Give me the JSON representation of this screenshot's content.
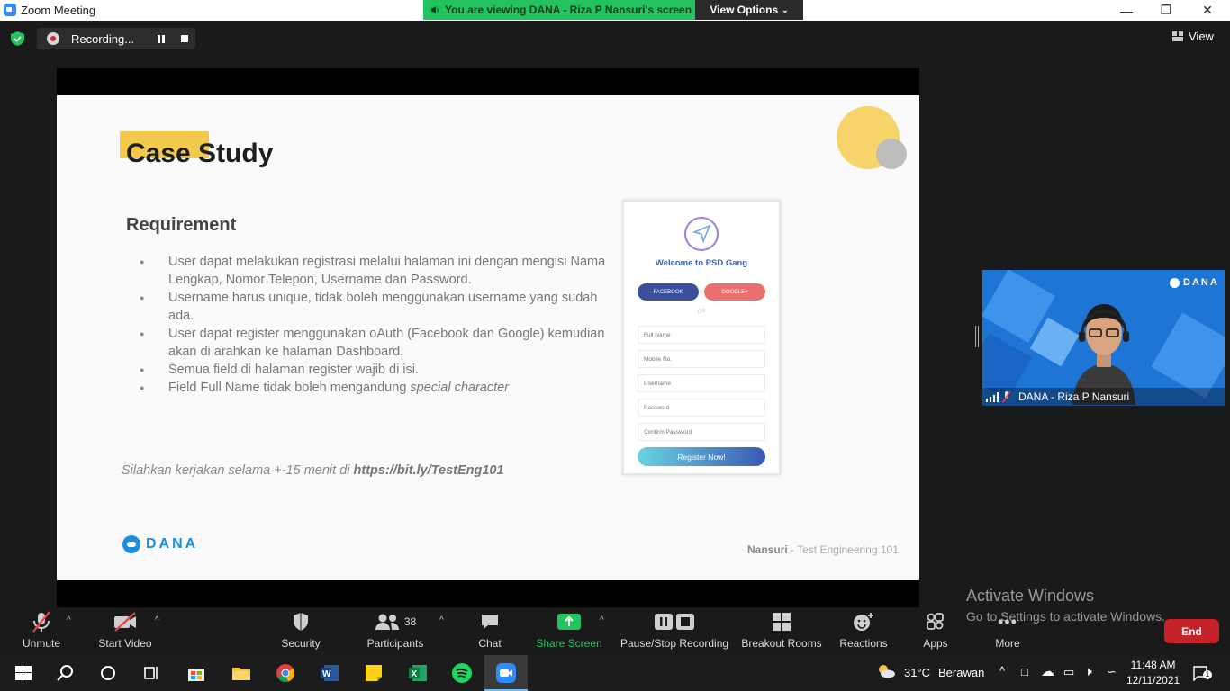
{
  "window": {
    "title": "Zoom Meeting"
  },
  "banner": {
    "text": "You are viewing DANA - Riza P Nansuri's screen",
    "view_options": "View Options"
  },
  "recording": {
    "label": "Recording..."
  },
  "view_button": "View",
  "slide": {
    "title": "Case Study",
    "subtitle": "Requirement",
    "requirements": [
      "User dapat melakukan registrasi melalui halaman ini dengan mengisi Nama Lengkap, Nomor Telepon, Username dan Password.",
      "Username harus unique, tidak boleh menggunakan username yang sudah ada.",
      "User dapat register menggunakan oAuth (Facebook dan Google) kemudian akan di arahkan ke halaman Dashboard.",
      "Semua field di halaman register wajib di isi."
    ],
    "req_last_prefix": "Field Full Name tidak boleh mengandung ",
    "req_last_italic": "special character",
    "note_prefix": "Silahkan kerjakan selama +-15 menit di ",
    "note_link": "https://bit.ly/TestEng101",
    "brand": "DANA",
    "footer_author": "Nansuri",
    "footer_rest": " - Test Engineering 101",
    "mockup": {
      "welcome": "Welcome to PSD Gang",
      "facebook": "FACEBOOK",
      "google": "GOOGLE+",
      "or": "OR",
      "fields": [
        "Full Name",
        "Mobile No.",
        "Username",
        "Password",
        "Confirm Password"
      ],
      "register": "Register Now!"
    }
  },
  "video": {
    "name": "DANA - Riza P Nansuri",
    "brand": "DANA"
  },
  "activate": {
    "line1": "Activate Windows",
    "line2": "Go to Settings to activate Windows."
  },
  "toolbar": {
    "unmute": "Unmute",
    "start_video": "Start Video",
    "security": "Security",
    "participants": "Participants",
    "participants_count": "38",
    "chat": "Chat",
    "share_screen": "Share Screen",
    "pause_stop": "Pause/Stop Recording",
    "breakout": "Breakout Rooms",
    "reactions": "Reactions",
    "apps": "Apps",
    "more": "More",
    "end": "End"
  },
  "taskbar": {
    "weather_temp": "31°C",
    "weather_desc": "Berawan",
    "time": "11:48 AM",
    "date": "12/11/2021",
    "notifications": "1"
  },
  "colors": {
    "zoom_blue": "#2d8cff",
    "banner_green": "#23c35f",
    "end_red": "#c6222a",
    "slide_yellow": "#f2c94c",
    "dana_blue": "#1b8ee0"
  }
}
